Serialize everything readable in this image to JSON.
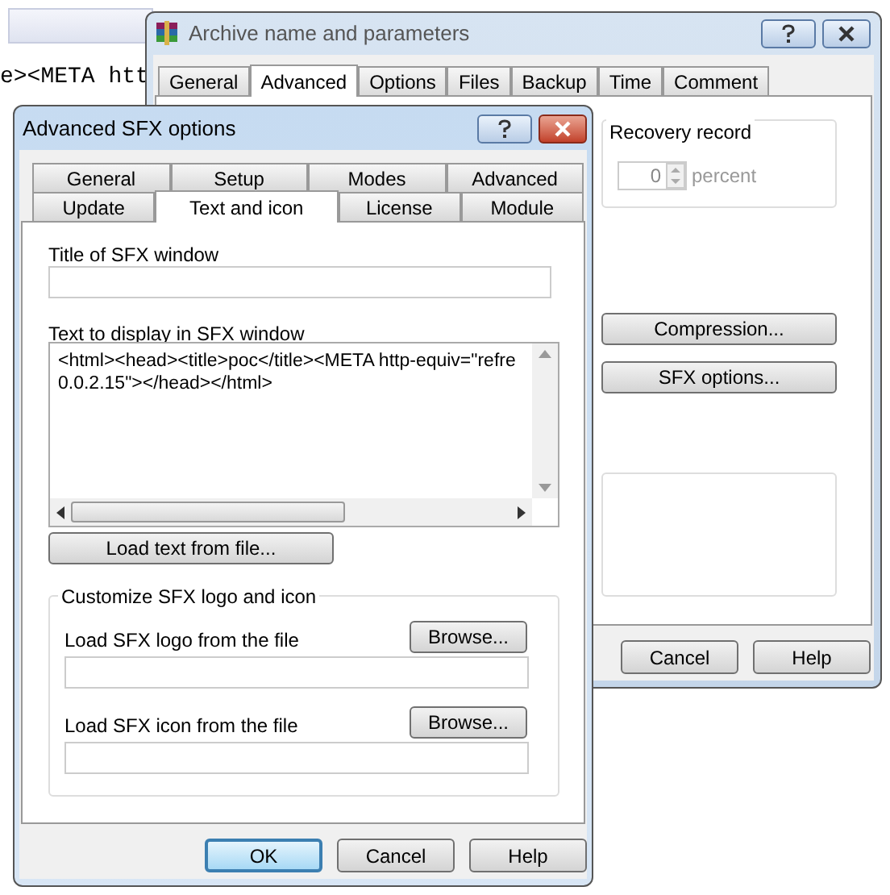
{
  "background": {
    "code_text": "e><META htt"
  },
  "back_window": {
    "title": "Archive name and parameters",
    "tabs": [
      {
        "label": "General",
        "selected": false
      },
      {
        "label": "Advanced",
        "selected": true
      },
      {
        "label": "Options",
        "selected": false
      },
      {
        "label": "Files",
        "selected": false
      },
      {
        "label": "Backup",
        "selected": false
      },
      {
        "label": "Time",
        "selected": false
      },
      {
        "label": "Comment",
        "selected": false
      }
    ],
    "recovery_record": {
      "label": "Recovery record",
      "value": "0",
      "unit": "percent",
      "disabled": true
    },
    "buttons": [
      "Compression...",
      "SFX options..."
    ],
    "footer_buttons": [
      "Cancel",
      "Help"
    ]
  },
  "front_window": {
    "title": "Advanced SFX options",
    "tab_rows": [
      [
        {
          "label": "General",
          "selected": false
        },
        {
          "label": "Setup",
          "selected": false
        },
        {
          "label": "Modes",
          "selected": false
        },
        {
          "label": "Advanced",
          "selected": false
        }
      ],
      [
        {
          "label": "Update",
          "selected": false
        },
        {
          "label": "Text and icon",
          "selected": true
        },
        {
          "label": "License",
          "selected": false
        },
        {
          "label": "Module",
          "selected": false
        }
      ]
    ],
    "title_label": "Title of SFX window",
    "text_label": "Text to display in SFX window",
    "text_lines": [
      "<html><head><title>poc</title><META http-equiv=\"refre",
      "0.0.2.15\"></head></html>"
    ],
    "load_button": "Load text from file...",
    "group": {
      "legend": "Customize SFX logo and icon",
      "rows": [
        {
          "label": "Load SFX logo from the file",
          "button": "Browse..."
        },
        {
          "label": "Load SFX icon from the file",
          "button": "Browse..."
        }
      ]
    },
    "footer_buttons": [
      {
        "label": "OK",
        "default": true
      },
      {
        "label": "Cancel",
        "default": false
      },
      {
        "label": "Help",
        "default": false
      }
    ]
  }
}
